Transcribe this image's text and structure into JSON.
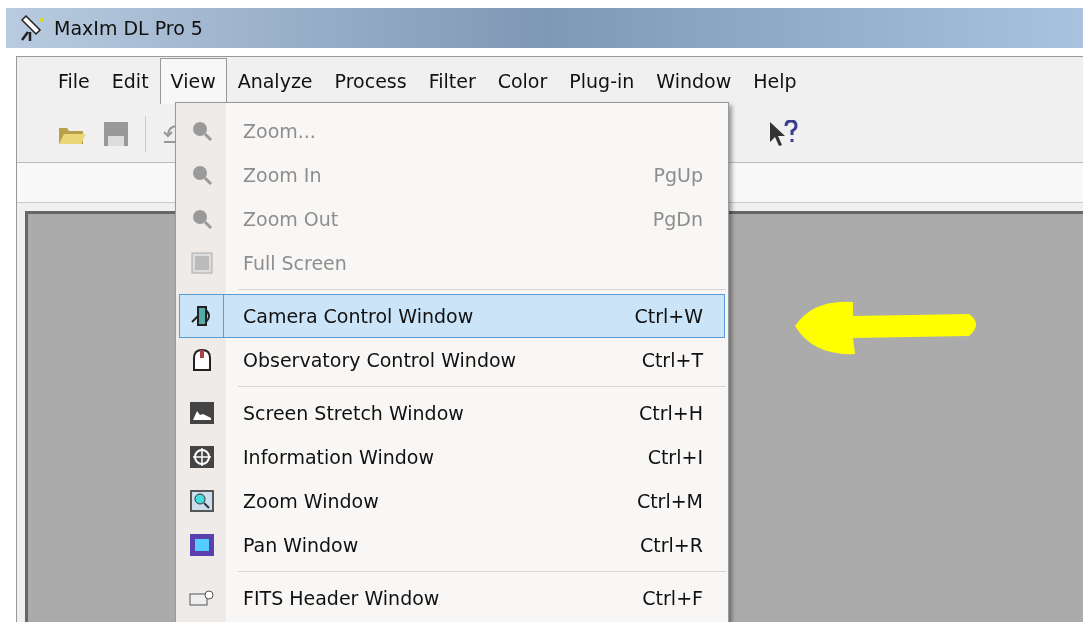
{
  "window": {
    "title": "MaxIm DL Pro 5"
  },
  "menu_bar": [
    {
      "label": "File",
      "selected": false
    },
    {
      "label": "Edit",
      "selected": false
    },
    {
      "label": "View",
      "selected": true
    },
    {
      "label": "Analyze",
      "selected": false
    },
    {
      "label": "Process",
      "selected": false
    },
    {
      "label": "Filter",
      "selected": false
    },
    {
      "label": "Color",
      "selected": false
    },
    {
      "label": "Plug-in",
      "selected": false
    },
    {
      "label": "Window",
      "selected": false
    },
    {
      "label": "Help",
      "selected": false
    }
  ],
  "view_menu": [
    {
      "kind": "item",
      "label": "Zoom...",
      "disabled": true,
      "selected": false
    },
    {
      "kind": "item",
      "label": "Zoom In",
      "shortcut": "PgUp",
      "disabled": true,
      "selected": false
    },
    {
      "kind": "item",
      "label": "Zoom Out",
      "shortcut": "PgDn",
      "disabled": true,
      "selected": false
    },
    {
      "kind": "item",
      "label": "Full Screen",
      "disabled": true,
      "selected": false
    },
    {
      "kind": "separator"
    },
    {
      "kind": "item",
      "label": "Camera Control Window",
      "shortcut": "Ctrl+W",
      "disabled": false,
      "selected": true
    },
    {
      "kind": "item",
      "label": "Observatory Control Window",
      "shortcut": "Ctrl+T",
      "disabled": false,
      "selected": false
    },
    {
      "kind": "separator"
    },
    {
      "kind": "item",
      "label": "Screen Stretch Window",
      "shortcut": "Ctrl+H",
      "disabled": false,
      "selected": false
    },
    {
      "kind": "item",
      "label": "Information Window",
      "shortcut": "Ctrl+I",
      "disabled": false,
      "selected": false
    },
    {
      "kind": "item",
      "label": "Zoom Window",
      "shortcut": "Ctrl+M",
      "disabled": false,
      "selected": false
    },
    {
      "kind": "item",
      "label": "Pan Window",
      "shortcut": "Ctrl+R",
      "disabled": false,
      "selected": false
    },
    {
      "kind": "separator"
    },
    {
      "kind": "item",
      "label": "FITS Header Window",
      "shortcut": "Ctrl+F",
      "disabled": false,
      "selected": false
    }
  ]
}
